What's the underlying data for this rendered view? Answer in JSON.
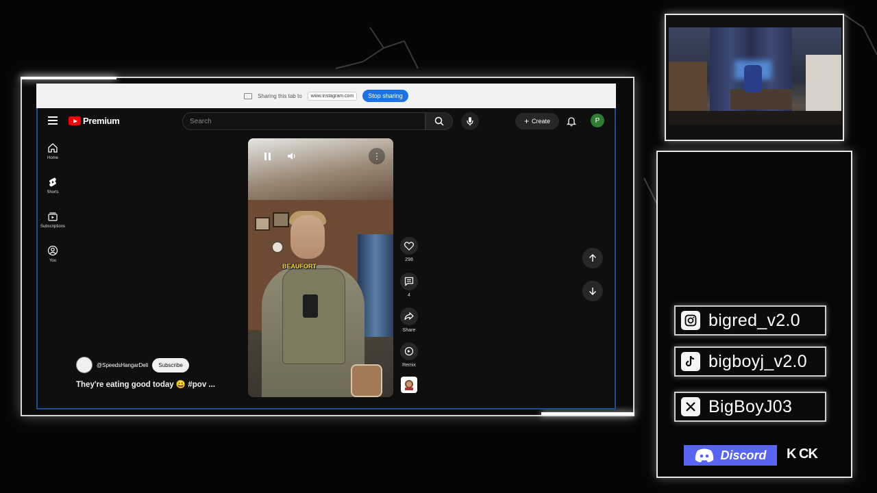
{
  "share_bar": {
    "message": "Sharing this tab to",
    "url": "www.instagram.com",
    "stop_label": "Stop sharing"
  },
  "youtube": {
    "logo_text": "Premium",
    "search_placeholder": "Search",
    "create_label": "Create",
    "avatar_letter": "P",
    "sidebar": [
      {
        "label": "Home",
        "icon": "home-icon"
      },
      {
        "label": "Shorts",
        "icon": "shorts-icon"
      },
      {
        "label": "Subscriptions",
        "icon": "subscriptions-icon"
      },
      {
        "label": "You",
        "icon": "you-icon"
      }
    ],
    "short": {
      "caption_overlay": "BEAUFORT",
      "channel": "@SpeedsHangarDeli",
      "subscribe_label": "Subscribe",
      "title": "They're eating good today 😀 #pov ...",
      "likes": "298",
      "comments": "4",
      "share_label": "Share",
      "remix_label": "Remix"
    }
  },
  "socials": {
    "instagram": "bigred_v2.0",
    "tiktok": "bigboyj_v2.0",
    "x": "BigBoyJ03",
    "discord": "Discord",
    "kick": "K CK"
  },
  "colors": {
    "yt_red": "#ff0000",
    "stop_blue": "#1a73e8",
    "discord_blurple": "#5865f2",
    "avatar_green": "#2e7d32"
  }
}
